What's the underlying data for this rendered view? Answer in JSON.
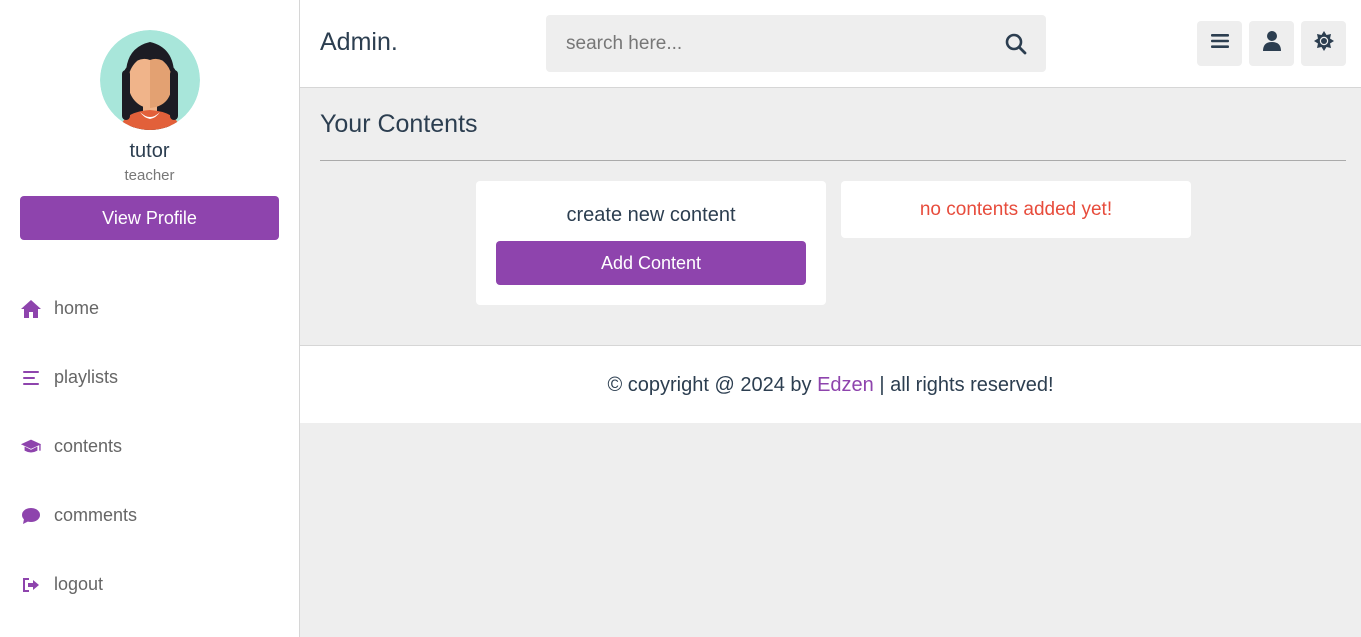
{
  "sidebar": {
    "profile": {
      "name": "tutor",
      "role": "teacher",
      "button_label": "View Profile"
    },
    "items": [
      {
        "label": "home",
        "icon": "home-icon"
      },
      {
        "label": "playlists",
        "icon": "list-icon"
      },
      {
        "label": "contents",
        "icon": "graduation-cap-icon"
      },
      {
        "label": "comments",
        "icon": "comment-icon"
      },
      {
        "label": "logout",
        "icon": "logout-icon"
      }
    ]
  },
  "header": {
    "logo": "Admin.",
    "search": {
      "placeholder": "search here..."
    }
  },
  "main": {
    "heading": "Your Contents",
    "create_box": {
      "title": "create new content",
      "button_label": "Add Content"
    },
    "empty_message": "no contents added yet!"
  },
  "footer": {
    "prefix": "© copyright @ 2024 by ",
    "brand": "Edzen",
    "suffix": " | all rights reserved!"
  },
  "colors": {
    "accent": "#8e44ad",
    "danger": "#e74c3c",
    "text": "#2c3e50",
    "background": "#eeeeee"
  }
}
